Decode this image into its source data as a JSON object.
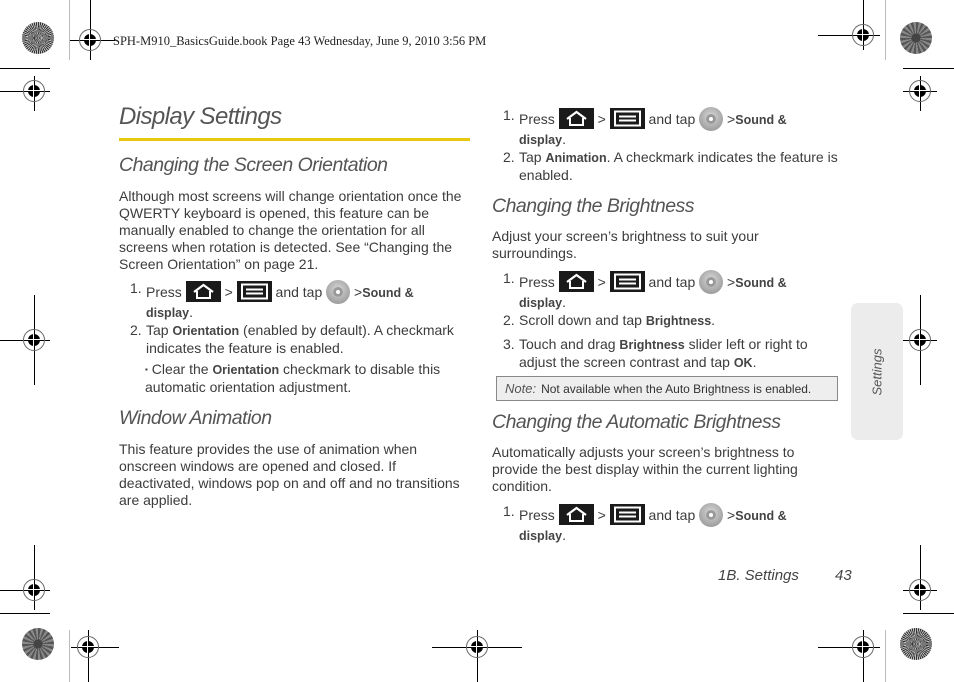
{
  "slug": "SPH-M910_BasicsGuide.book  Page 43  Wednesday, June 9, 2010  3:56 PM",
  "page_title": "Display Settings",
  "accent_color": "#e8c80f",
  "left": {
    "orientation": {
      "heading": "Changing the Screen Orientation",
      "intro": "Although most screens will change orientation once the QWERTY keyboard is opened, this feature can be manually enabled to change the orientation for all screens when rotation is detected. See “Changing the Screen Orientation” on page 21.",
      "step1": {
        "num": "1.",
        "press": "Press",
        "gt1": ">",
        "and_tap": "and tap",
        "gt2": ">",
        "target": "Sound &",
        "target2": "display",
        "end": "."
      },
      "step2": {
        "num": "2.",
        "pre": "Tap",
        "ui": "Orientation",
        "post": "(enabled by default). A checkmark indicates the feature is enabled."
      },
      "bullet": {
        "mark": "▪",
        "pre": "Clear the",
        "ui": "Orientation",
        "post": "checkmark to disable this automatic orientation adjustment."
      }
    },
    "animation": {
      "heading": "Window Animation",
      "intro": "This feature provides the use of animation when onscreen windows are opened and closed. If deactivated, windows pop on and off and no transitions are applied."
    }
  },
  "right": {
    "animation_steps": {
      "step1": {
        "num": "1.",
        "press": "Press",
        "gt1": ">",
        "and_tap": "and tap",
        "gt2": ">",
        "target": "Sound &",
        "target2": "display",
        "end": "."
      },
      "step2": {
        "num": "2.",
        "pre": "Tap",
        "ui": "Animation",
        "post": ". A checkmark indicates the feature is enabled."
      }
    },
    "brightness": {
      "heading": "Changing the Brightness",
      "intro": "Adjust your screen’s brightness to suit your surroundings.",
      "step1": {
        "num": "1.",
        "press": "Press",
        "gt1": ">",
        "and_tap": "and tap",
        "gt2": ">",
        "target": "Sound &",
        "target2": "display",
        "end": "."
      },
      "step2": {
        "num": "2.",
        "pre": "Scroll down and tap",
        "ui": "Brightness",
        "post": "."
      },
      "step3": {
        "num": "3.",
        "pre": "Touch and drag",
        "ui": "Brightness",
        "post": "slider left or right to adjust the screen contrast and tap",
        "ui2": "OK",
        "end": "."
      },
      "note": {
        "label": "Note:",
        "text": "Not available when the Auto Brightness is enabled."
      }
    },
    "auto_brightness": {
      "heading": "Changing the Automatic Brightness",
      "intro": "Automatically adjusts your screen’s brightness to provide the best display within the current lighting condition.",
      "step1": {
        "num": "1.",
        "press": "Press",
        "gt1": ">",
        "and_tap": "and tap",
        "gt2": ">",
        "target": "Sound &",
        "target2": "display",
        "end": "."
      }
    }
  },
  "side_tab": "Settings",
  "footer": {
    "section": "1B. Settings",
    "page": "43"
  },
  "icons": {
    "home": "home-key-icon",
    "menu": "menu-key-icon",
    "settings": "settings-icon"
  }
}
